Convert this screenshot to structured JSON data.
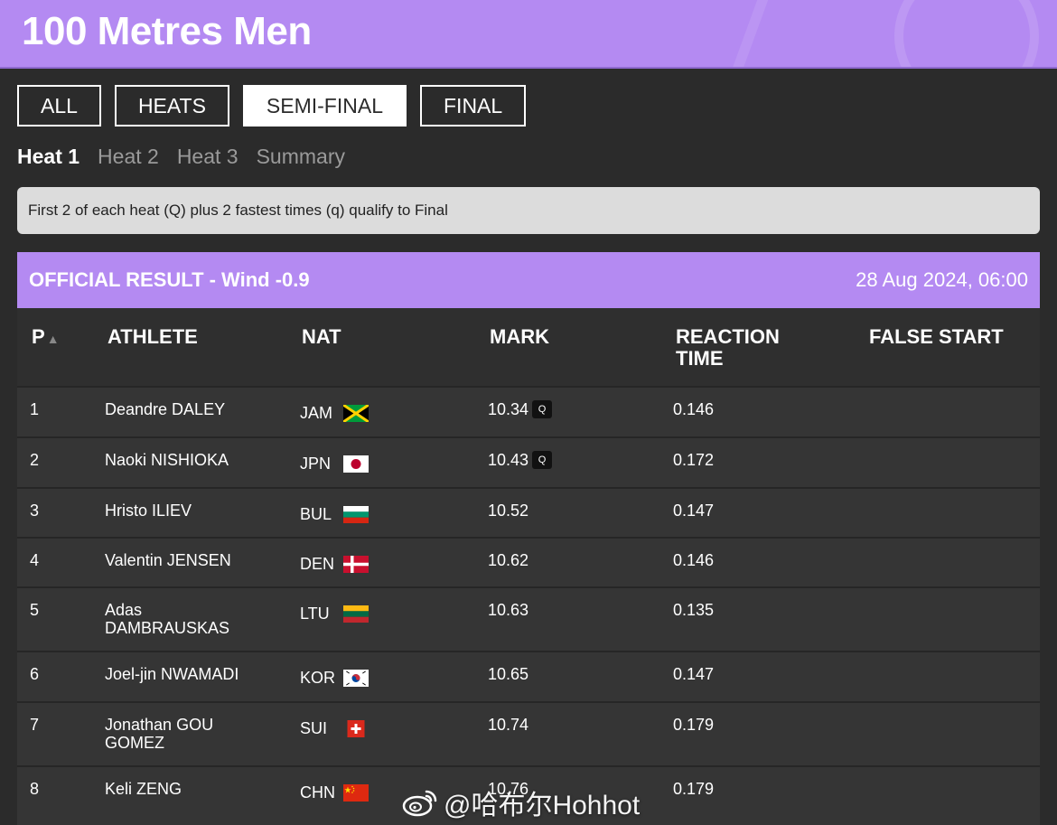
{
  "header": {
    "title": "100 Metres Men"
  },
  "filters": [
    {
      "label": "ALL",
      "active": false
    },
    {
      "label": "HEATS",
      "active": false
    },
    {
      "label": "SEMI-FINAL",
      "active": true
    },
    {
      "label": "FINAL",
      "active": false
    }
  ],
  "heat_tabs": [
    {
      "label": "Heat 1",
      "active": true
    },
    {
      "label": "Heat 2",
      "active": false
    },
    {
      "label": "Heat 3",
      "active": false
    },
    {
      "label": "Summary",
      "active": false
    }
  ],
  "info": {
    "text": "First 2 of each heat (Q) plus 2 fastest times (q) qualify to Final"
  },
  "result": {
    "title": "OFFICIAL RESULT - Wind -0.9",
    "date": "28 Aug 2024, 06:00"
  },
  "table": {
    "headers": {
      "p": "P",
      "athlete": "ATHLETE",
      "nat": "NAT",
      "mark": "MARK",
      "reaction_line1": "REACTION",
      "reaction_line2": "TIME",
      "false_start": "FALSE START"
    },
    "rows": [
      {
        "p": "1",
        "athlete": "Deandre DALEY",
        "nat": "JAM",
        "mark": "10.34",
        "q": "Q",
        "reaction": "0.146"
      },
      {
        "p": "2",
        "athlete": "Naoki NISHIOKA",
        "nat": "JPN",
        "mark": "10.43",
        "q": "Q",
        "reaction": "0.172"
      },
      {
        "p": "3",
        "athlete": "Hristo ILIEV",
        "nat": "BUL",
        "mark": "10.52",
        "q": "",
        "reaction": "0.147"
      },
      {
        "p": "4",
        "athlete": "Valentin JENSEN",
        "nat": "DEN",
        "mark": "10.62",
        "q": "",
        "reaction": "0.146"
      },
      {
        "p": "5",
        "athlete": "Adas DAMBRAUSKAS",
        "nat": "LTU",
        "mark": "10.63",
        "q": "",
        "reaction": "0.135"
      },
      {
        "p": "6",
        "athlete": "Joel-jin NWAMADI",
        "nat": "KOR",
        "mark": "10.65",
        "q": "",
        "reaction": "0.147"
      },
      {
        "p": "7",
        "athlete": "Jonathan GOU GOMEZ",
        "nat": "SUI",
        "mark": "10.74",
        "q": "",
        "reaction": "0.179"
      },
      {
        "p": "8",
        "athlete": "Keli ZENG",
        "nat": "CHN",
        "mark": "10.76",
        "q": "",
        "reaction": "0.179"
      }
    ]
  },
  "watermark": {
    "text": "@哈布尔Hohhot"
  },
  "colors": {
    "accent": "#b48af2",
    "background": "#2b2b2b",
    "row": "#353535"
  }
}
